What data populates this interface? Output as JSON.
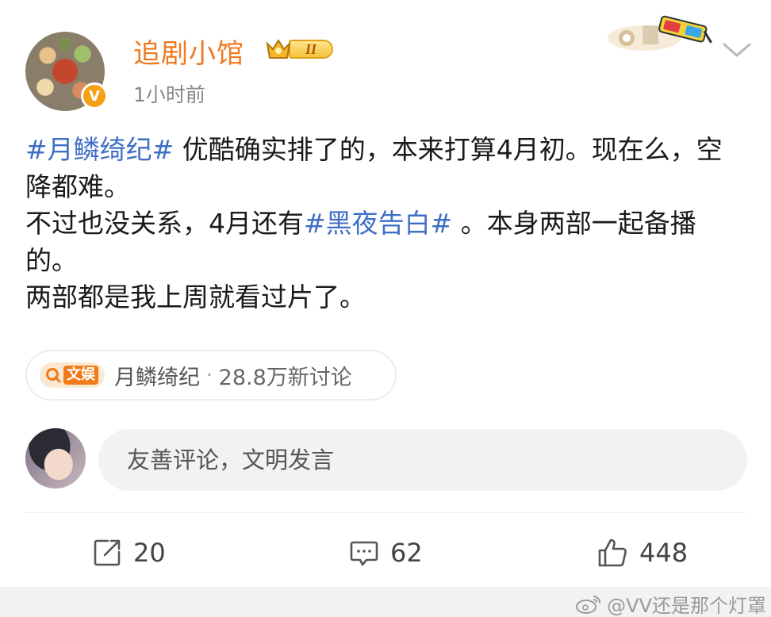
{
  "post": {
    "username": "追剧小馆",
    "level": "II",
    "time": "1小时前",
    "text": {
      "line1_topic": "#月鳞绮纪#",
      "line1_rest": " 优酷确实排了的，本来打算4月初。现在么，空降都难。",
      "line2_before": "不过也没关系，4月还有",
      "line2_topic": "#黑夜告白#",
      "line2_after": " 。本身两部一起备播的。",
      "line3": "两部都是我上周就看过片了。"
    },
    "topic_chip": {
      "badge": "文娱",
      "name": "月鳞绮纪",
      "separator": "·",
      "discussions": "28.8万新讨论"
    }
  },
  "comment_input": {
    "placeholder": "友善评论，文明发言"
  },
  "actions": {
    "repost_count": "20",
    "comment_count": "62",
    "like_count": "448"
  },
  "watermark": "@VV还是那个灯罩",
  "icons": {
    "verified": "verified-v-icon",
    "repost": "repost-icon",
    "comment": "comment-icon",
    "like": "thumbs-up-icon",
    "more": "chevron-down-icon"
  },
  "colors": {
    "username": "#f0781e",
    "topic": "#3f6ec7",
    "verified": "#f6a015",
    "chip_accent": "#f07a18"
  }
}
